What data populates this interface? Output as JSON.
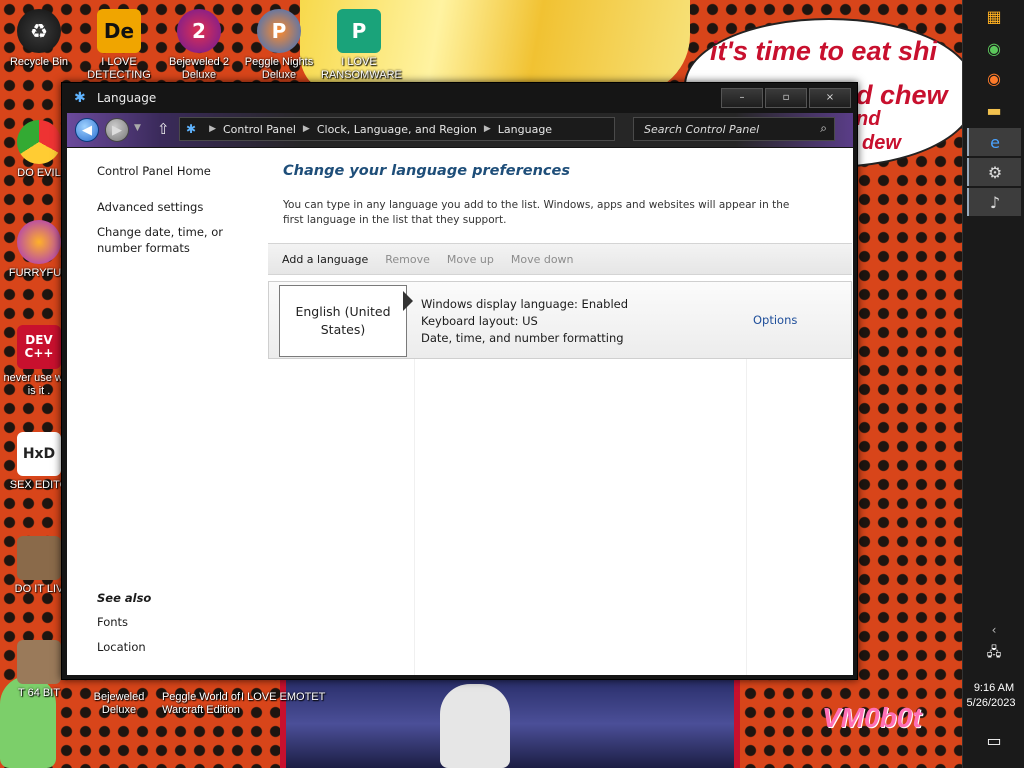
{
  "desktop": {
    "icons": [
      {
        "label": "Recycle Bin"
      },
      {
        "label": "I LOVE DETECTING",
        "glyph": "De"
      },
      {
        "label": "Bejeweled 2 Deluxe",
        "glyph": "2"
      },
      {
        "label": "Peggle Nights Deluxe",
        "glyph": "P"
      },
      {
        "label": "I LOVE RANSOMWARE",
        "glyph": "P"
      },
      {
        "label": "DO EVIL"
      },
      {
        "label": "FURRYFUC"
      },
      {
        "label": "never use why is it ."
      },
      {
        "label": "SEX EDITO"
      },
      {
        "label": "DO IT LIV"
      },
      {
        "label": "T 64 BIT"
      },
      {
        "label": "Bejeweled Deluxe"
      },
      {
        "label": "Peggle World of Warcraft Edition"
      },
      {
        "label": "I LOVE EMOTET"
      }
    ],
    "devcpp_glyph": "DEV C++",
    "hxd_glyph": "HxD",
    "bubble_line1": "it's time to eat shi",
    "bubble_line2": "d chew",
    "bubble_line3": "nd",
    "bubble_line4": "dew",
    "watermark": "VM0b0t"
  },
  "taskbar": {
    "time": "9:16 AM",
    "date": "5/26/2023",
    "chevron": "‹"
  },
  "window": {
    "title": "Language",
    "controls": {
      "minimize": "–",
      "maximize": "▫",
      "close": "×"
    },
    "breadcrumb": [
      "Control Panel",
      "Clock, Language, and Region",
      "Language"
    ],
    "search_placeholder": "Search Control Panel",
    "sidebar": {
      "home": "Control Panel Home",
      "advanced": "Advanced settings",
      "change_date": "Change date, time, or number formats",
      "see_also": "See also",
      "fonts": "Fonts",
      "location": "Location"
    },
    "main": {
      "title": "Change your language preferences",
      "description": "You can type in any language you add to the list. Windows, apps and websites will appear in the first language in the list that they support.",
      "toolbar": {
        "add": "Add a language",
        "remove": "Remove",
        "move_up": "Move up",
        "move_down": "Move down"
      },
      "languages": [
        {
          "name": "English (United States)",
          "info1": "Windows display language: Enabled",
          "info2": "Keyboard layout: US",
          "info3": "Date, time, and number formatting",
          "options": "Options"
        }
      ]
    }
  },
  "colors": {
    "link": "#1e4e9a",
    "heading": "#1e4e79",
    "accent_purple": "#6b4a9c"
  }
}
